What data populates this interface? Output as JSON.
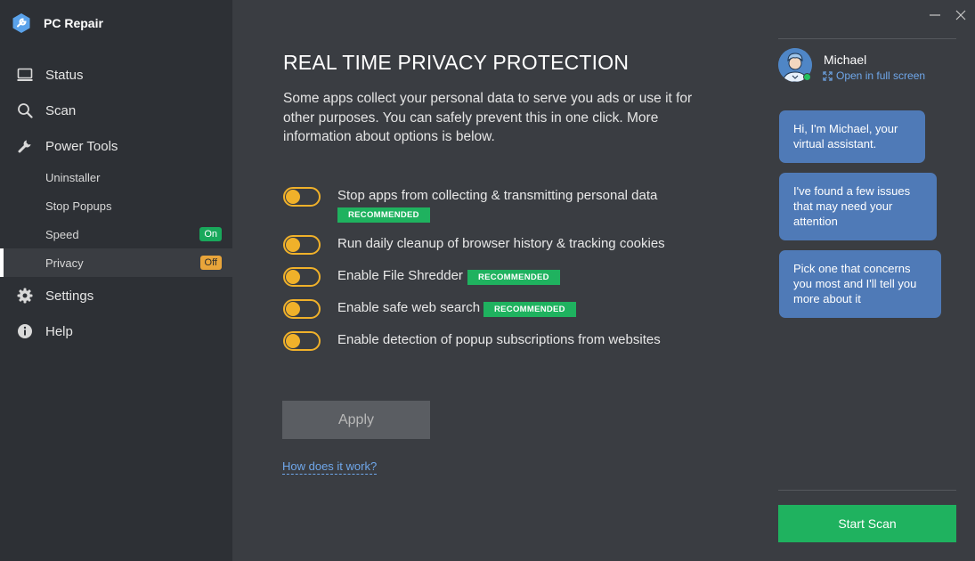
{
  "app": {
    "title": "PC Repair"
  },
  "sidebar": {
    "items": [
      {
        "label": "Status",
        "icon": "monitor-icon"
      },
      {
        "label": "Scan",
        "icon": "search-icon"
      },
      {
        "label": "Power Tools",
        "icon": "wrench-icon"
      }
    ],
    "subitems": [
      {
        "label": "Uninstaller"
      },
      {
        "label": "Stop Popups"
      },
      {
        "label": "Speed",
        "badge": "On"
      },
      {
        "label": "Privacy",
        "badge": "Off",
        "active": true
      }
    ],
    "bottom_items": [
      {
        "label": "Settings",
        "icon": "gear-icon"
      },
      {
        "label": "Help",
        "icon": "info-icon"
      }
    ]
  },
  "main": {
    "title": "REAL TIME PRIVACY PROTECTION",
    "description": "Some apps collect your personal data to serve you ads or use it for other purposes. You can safely prevent this in one click. More information about options is below.",
    "options": [
      {
        "label": "Stop apps from collecting & transmitting personal data",
        "recommended": "RECOMMENDED"
      },
      {
        "label": "Run daily cleanup of browser history & tracking cookies",
        "recommended": ""
      },
      {
        "label": "Enable File Shredder",
        "recommended": "RECOMMENDED"
      },
      {
        "label": "Enable safe web search",
        "recommended": "RECOMMENDED"
      },
      {
        "label": "Enable detection of popup subscriptions from websites",
        "recommended": ""
      }
    ],
    "apply_label": "Apply",
    "how_link": "How does it work?"
  },
  "assistant": {
    "name": "Michael",
    "fullscreen_label": "Open in full screen",
    "messages": [
      "Hi, I'm Michael, your virtual assistant.",
      "I've found a few issues that may need your attention",
      "Pick one that concerns you most and I'll tell you more about it"
    ],
    "start_scan_label": "Start Scan"
  },
  "colors": {
    "accent_toggle": "#f0b12a",
    "recommended": "#1fb25f",
    "link": "#6fa7ea",
    "bubble": "#4f7ab7",
    "sidebar_bg": "#2d3035",
    "main_bg": "#3a3d42"
  }
}
